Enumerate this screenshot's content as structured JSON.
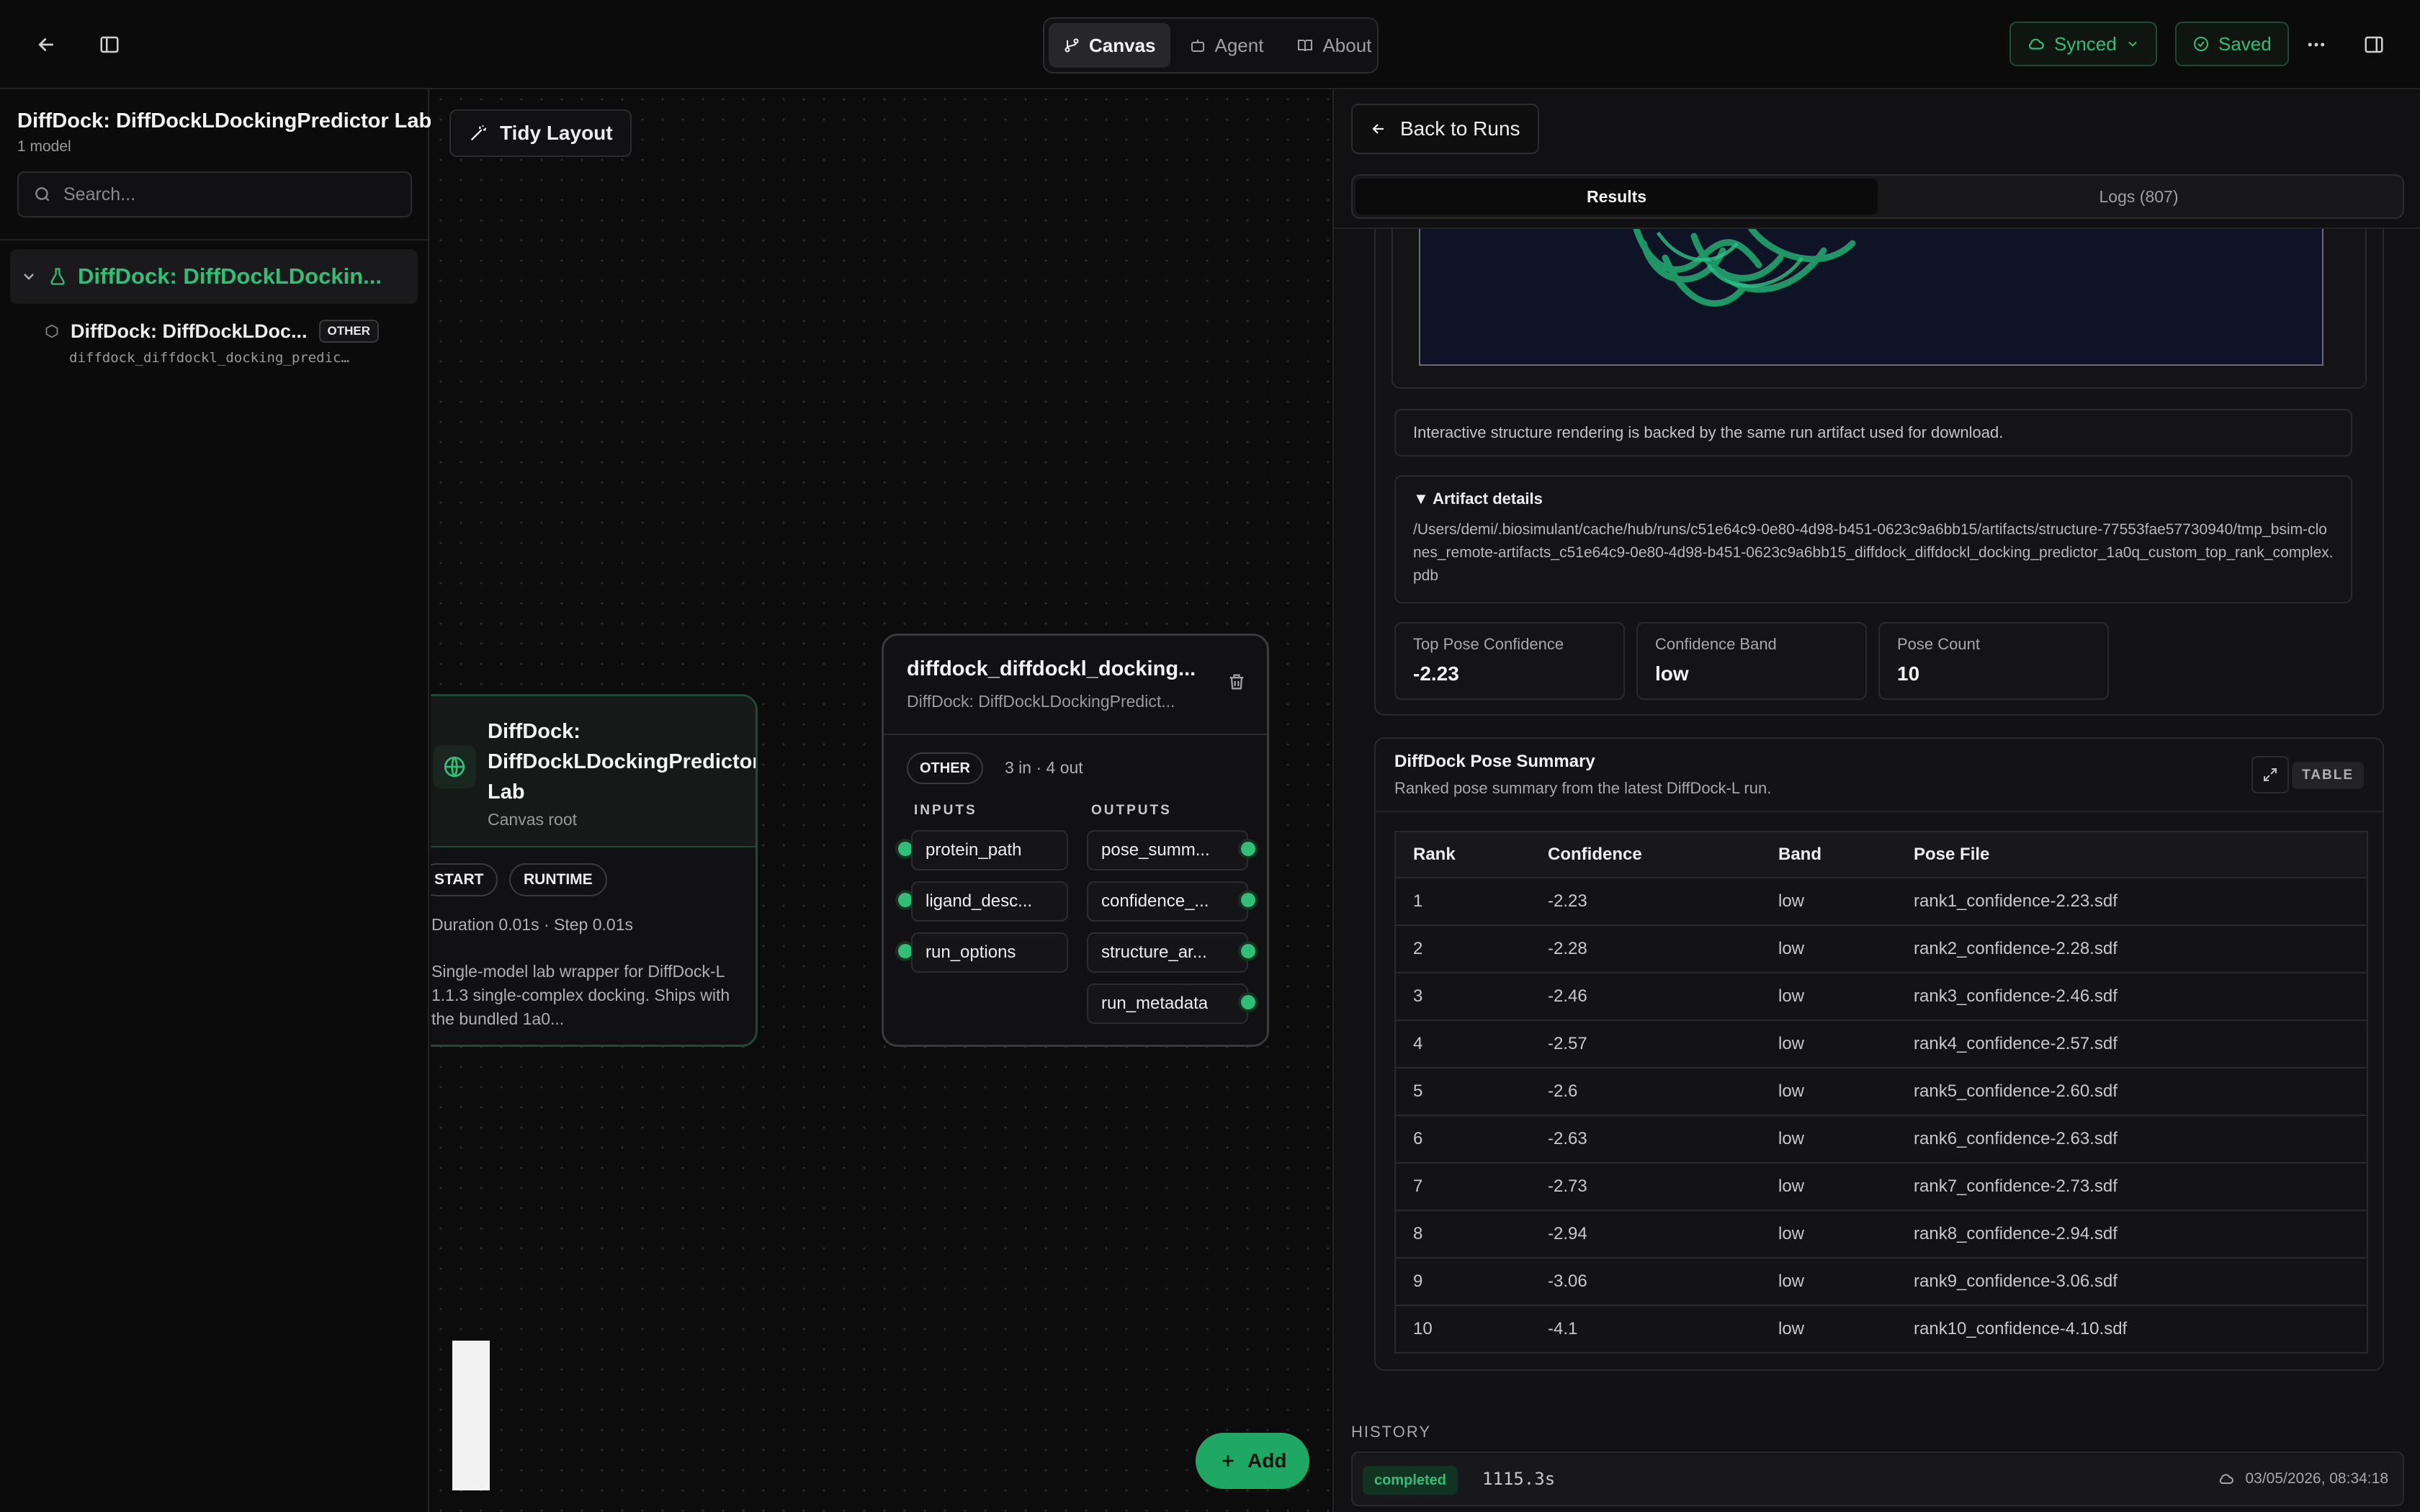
{
  "topbar": {
    "tabs": [
      {
        "label": "Canvas",
        "icon": "git-branch-icon",
        "active": true
      },
      {
        "label": "Agent",
        "icon": "bot-icon",
        "active": false
      },
      {
        "label": "About",
        "icon": "book-icon",
        "active": false
      }
    ],
    "synced_label": "Synced",
    "saved_label": "Saved"
  },
  "sidebar": {
    "title": "DiffDock: DiffDockLDockingPredictor Lab",
    "subtitle": "1 model",
    "search_placeholder": "Search...",
    "root_label": "DiffDock: DiffDockLDockin...",
    "child_label": "DiffDock: DiffDockLDoc...",
    "child_badge": "OTHER",
    "child_id": "diffdock_diffdockl_docking_predic…"
  },
  "canvas": {
    "tidy_label": "Tidy Layout",
    "root_node": {
      "title": "DiffDock: DiffDockLDockingPredictor Lab",
      "subtitle": "Canvas root",
      "chip_start": "START",
      "chip_runtime": "RUNTIME",
      "duration": "Duration 0.01s · Step 0.01s",
      "description": "Single-model lab wrapper for DiffDock-L 1.1.3 single-complex docking. Ships with the bundled 1a0..."
    },
    "model_node": {
      "title": "diffdock_diffdockl_docking...",
      "subtitle": "DiffDock: DiffDockLDockingPredict...",
      "badge": "OTHER",
      "counts": "3 in · 4 out",
      "inputs_label": "INPUTS",
      "outputs_label": "OUTPUTS",
      "inputs": [
        "protein_path",
        "ligand_desc...",
        "run_options"
      ],
      "outputs": [
        "pose_summ...",
        "confidence_...",
        "structure_ar...",
        "run_metadata"
      ]
    },
    "add_label": "Add"
  },
  "panel": {
    "back_label": "Back to Runs",
    "tab_results": "Results",
    "tab_logs": "Logs (807)",
    "note": "Interactive structure rendering is backed by the same run artifact used for download.",
    "details_heading": "▼ Artifact details",
    "details_path": "/Users/demi/.biosimulant/cache/hub/runs/c51e64c9-0e80-4d98-b451-0623c9a6bb15/artifacts/structure-77553fae57730940/tmp_bsim-clones_remote-artifacts_c51e64c9-0e80-4d98-b451-0623c9a6bb15_diffdock_diffdockl_docking_predictor_1a0q_custom_top_rank_complex.pdb",
    "stats": [
      {
        "label": "Top Pose Confidence",
        "value": "-2.23"
      },
      {
        "label": "Confidence Band",
        "value": "low"
      },
      {
        "label": "Pose Count",
        "value": "10"
      }
    ],
    "pose_title": "DiffDock Pose Summary",
    "pose_subtitle": "Ranked pose summary from the latest DiffDock-L run.",
    "table_badge": "TABLE",
    "columns": [
      "Rank",
      "Confidence",
      "Band",
      "Pose File"
    ],
    "rows": [
      [
        "1",
        "-2.23",
        "low",
        "rank1_confidence-2.23.sdf"
      ],
      [
        "2",
        "-2.28",
        "low",
        "rank2_confidence-2.28.sdf"
      ],
      [
        "3",
        "-2.46",
        "low",
        "rank3_confidence-2.46.sdf"
      ],
      [
        "4",
        "-2.57",
        "low",
        "rank4_confidence-2.57.sdf"
      ],
      [
        "5",
        "-2.6",
        "low",
        "rank5_confidence-2.60.sdf"
      ],
      [
        "6",
        "-2.63",
        "low",
        "rank6_confidence-2.63.sdf"
      ],
      [
        "7",
        "-2.73",
        "low",
        "rank7_confidence-2.73.sdf"
      ],
      [
        "8",
        "-2.94",
        "low",
        "rank8_confidence-2.94.sdf"
      ],
      [
        "9",
        "-3.06",
        "low",
        "rank9_confidence-3.06.sdf"
      ],
      [
        "10",
        "-4.1",
        "low",
        "rank10_confidence-4.10.sdf"
      ]
    ],
    "history_label": "HISTORY",
    "history": {
      "status": "completed",
      "duration": "1115.3s",
      "timestamp": "03/05/2026, 08:34:18"
    }
  },
  "colors": {
    "accent": "#2fbf76",
    "background": "#0c0c0d",
    "viewer_bg": "#0e1326"
  }
}
